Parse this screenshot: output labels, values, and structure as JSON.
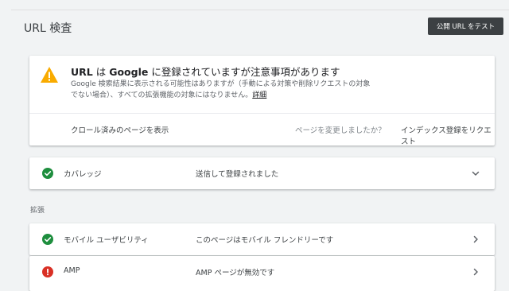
{
  "header": {
    "title": "URL 検査",
    "test_button": "公開 URL をテスト"
  },
  "status": {
    "heading_bold_1": "URL",
    "heading_normal_1": " は ",
    "heading_bold_2": "Google",
    "heading_normal_2": " に登録されていますが注意事項があります",
    "description": "Google 検索結果に表示される可能性はありますが（手動による対策や削除リクエストの対象でない場合）、すべての拡張機能の対象にはなりません。",
    "details_link": "詳細",
    "crawl_link": "クロール済みのページを表示",
    "changed_question": "ページを変更しましたか？",
    "request_indexing": "インデックス登録をリクエスト",
    "warning_color": "#f9ab00"
  },
  "coverage": {
    "label": "カバレッジ",
    "value": "送信して登録されました",
    "status": "valid",
    "icon": "check-circle-icon"
  },
  "enhancements": {
    "section_label": "拡張",
    "rows": [
      {
        "label": "モバイル ユーザビリティ",
        "value": "このページはモバイル フレンドリーです",
        "status": "valid",
        "icon": "check-circle-icon"
      },
      {
        "label": "AMP",
        "value": "AMP ページが無効です",
        "status": "error",
        "icon": "error-circle-icon"
      }
    ]
  },
  "colors": {
    "valid": "#1e8e3e",
    "error": "#d93025",
    "warning": "#f9ab00"
  }
}
